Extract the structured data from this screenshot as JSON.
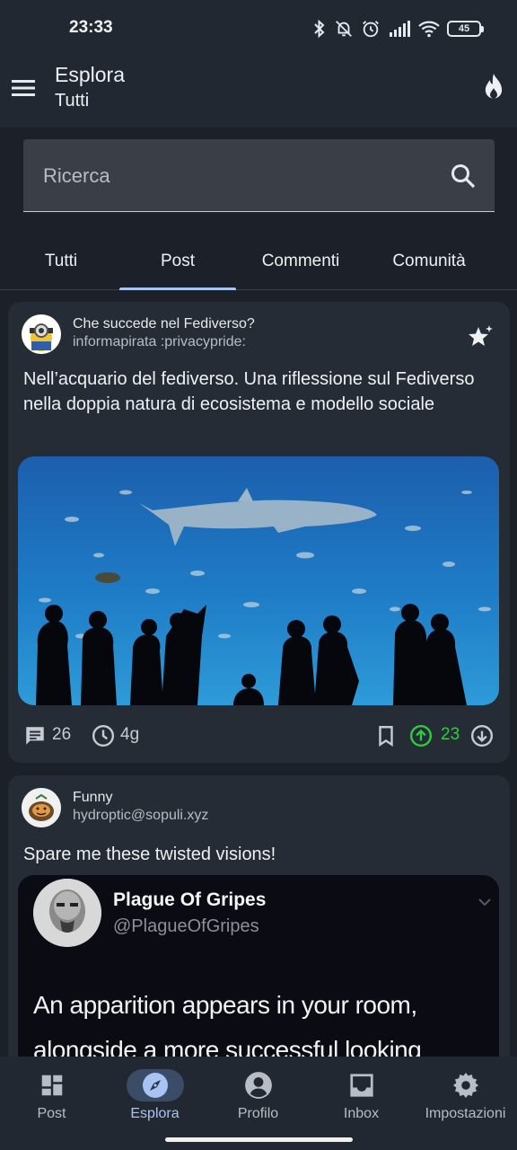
{
  "status_bar": {
    "time": "23:33",
    "battery": "45"
  },
  "app_bar": {
    "title": "Esplora",
    "subtitle": "Tutti"
  },
  "search": {
    "placeholder": "Ricerca"
  },
  "tabs": [
    {
      "label": "Tutti",
      "active": false
    },
    {
      "label": "Post",
      "active": true
    },
    {
      "label": "Commenti",
      "active": false
    },
    {
      "label": "Comunità",
      "active": false
    }
  ],
  "posts": [
    {
      "community": "Che succede nel Fediverso?",
      "author": "informapirata :privacypride:",
      "title": "Nell’acquario del fediverso. Una riflessione sul Fediverso nella doppia natura di ecosistema e modello sociale",
      "comments": "26",
      "age": "4g",
      "score": "23"
    },
    {
      "community": "Funny",
      "author": "hydroptic@sopuli.xyz",
      "title": "Spare me these twisted visions!",
      "embed": {
        "name": "Plague Of Gripes",
        "handle": "@PlagueOfGripes",
        "text": "An apparition appears in your room, alongside a more successful looking"
      }
    }
  ],
  "bottom_nav": [
    {
      "label": "Post",
      "icon": "dashboard-icon"
    },
    {
      "label": "Esplora",
      "icon": "compass-icon",
      "active": true
    },
    {
      "label": "Profilo",
      "icon": "account-circle-icon"
    },
    {
      "label": "Inbox",
      "icon": "inbox-icon"
    },
    {
      "label": "Impostazioni",
      "icon": "gear-icon"
    }
  ],
  "colors": {
    "accent": "#a8c4f3",
    "upvote": "#2ecc40",
    "background": "#1c2129",
    "card": "#262c35"
  }
}
